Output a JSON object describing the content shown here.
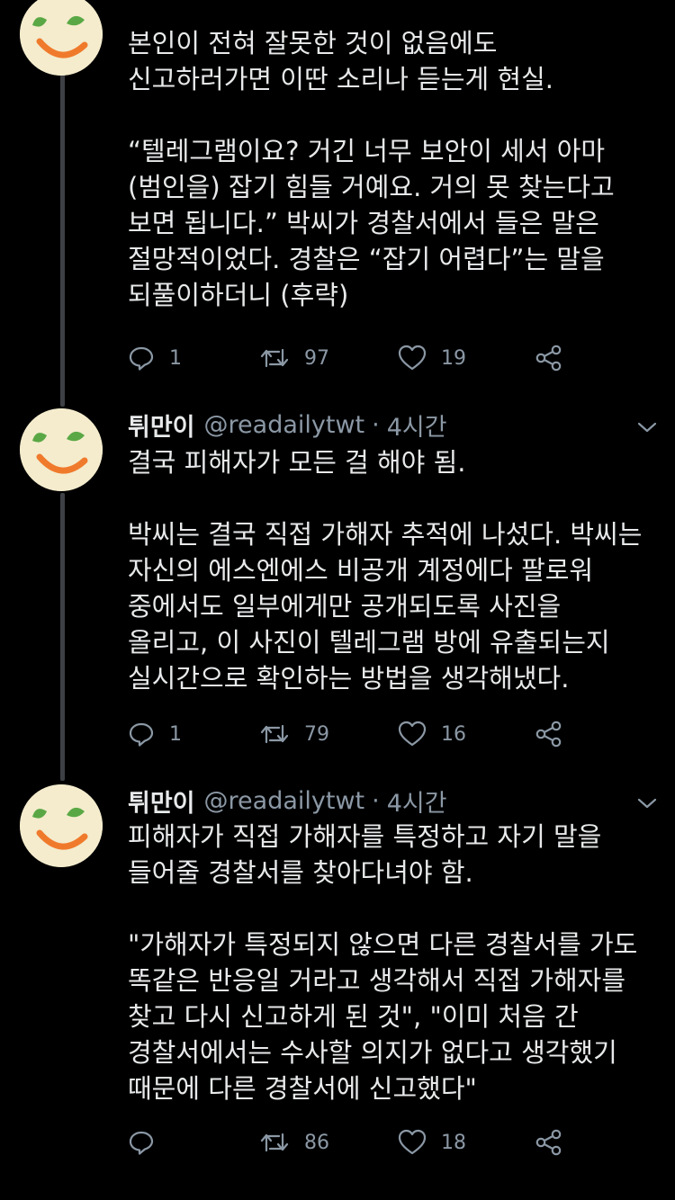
{
  "tweets": [
    {
      "show_header": false,
      "name": "",
      "handle": "",
      "time": "",
      "text": "본인이 전혀 잘못한 것이 없음에도\n신고하러가면 이딴 소리나 듣는게 현실.\n\n“텔레그램이요? 거긴 너무 보안이 세서 아마\n(범인을) 잡기 힘들 거예요. 거의 못 찾는다고\n보면 됩니다.” 박씨가 경찰서에서 들은 말은\n절망적이었다. 경찰은 “잡기 어렵다”는 말을\n되풀이하더니 (후략)",
      "replies": "1",
      "retweets": "97",
      "likes": "19"
    },
    {
      "show_header": true,
      "name": "튀만이",
      "handle": "@readailytwt",
      "time": "4시간",
      "text": "결국 피해자가 모든 걸 해야 됨.\n\n박씨는 결국 직접 가해자 추적에 나섰다. 박씨는\n자신의 에스엔에스 비공개 계정에다 팔로워\n중에서도 일부에게만 공개되도록 사진을\n올리고, 이 사진이 텔레그램 방에 유출되는지\n실시간으로 확인하는 방법을 생각해냈다.",
      "replies": "1",
      "retweets": "79",
      "likes": "16"
    },
    {
      "show_header": true,
      "name": "튀만이",
      "handle": "@readailytwt",
      "time": "4시간",
      "text": "피해자가 직접 가해자를 특정하고 자기 말을\n들어줄 경찰서를 찾아다녀야 함.\n\n\"가해자가 특정되지 않으면 다른 경찰서를 가도\n똑같은 반응일 거라고 생각해서 직접 가해자를\n찾고 다시 신고하게 된 것\", \"이미 처음 간\n경찰서에서는 수사할 의지가 없다고 생각했기\n때문에 다른 경찰서에 신고했다\"",
      "replies": "",
      "retweets": "86",
      "likes": "18"
    }
  ],
  "header_dot": "·",
  "colors": {
    "background": "#000000",
    "text": "#e7e9ea",
    "secondary": "#8b98a5",
    "thread_line": "#3d4145",
    "avatar_bg": "#f4eccd",
    "avatar_eyes": "#5aa845",
    "avatar_mouth": "#f07a2c"
  },
  "icons": {
    "reply": "reply-icon",
    "retweet": "retweet-icon",
    "like": "like-icon",
    "share": "share-icon",
    "more": "chevron-down-icon"
  }
}
